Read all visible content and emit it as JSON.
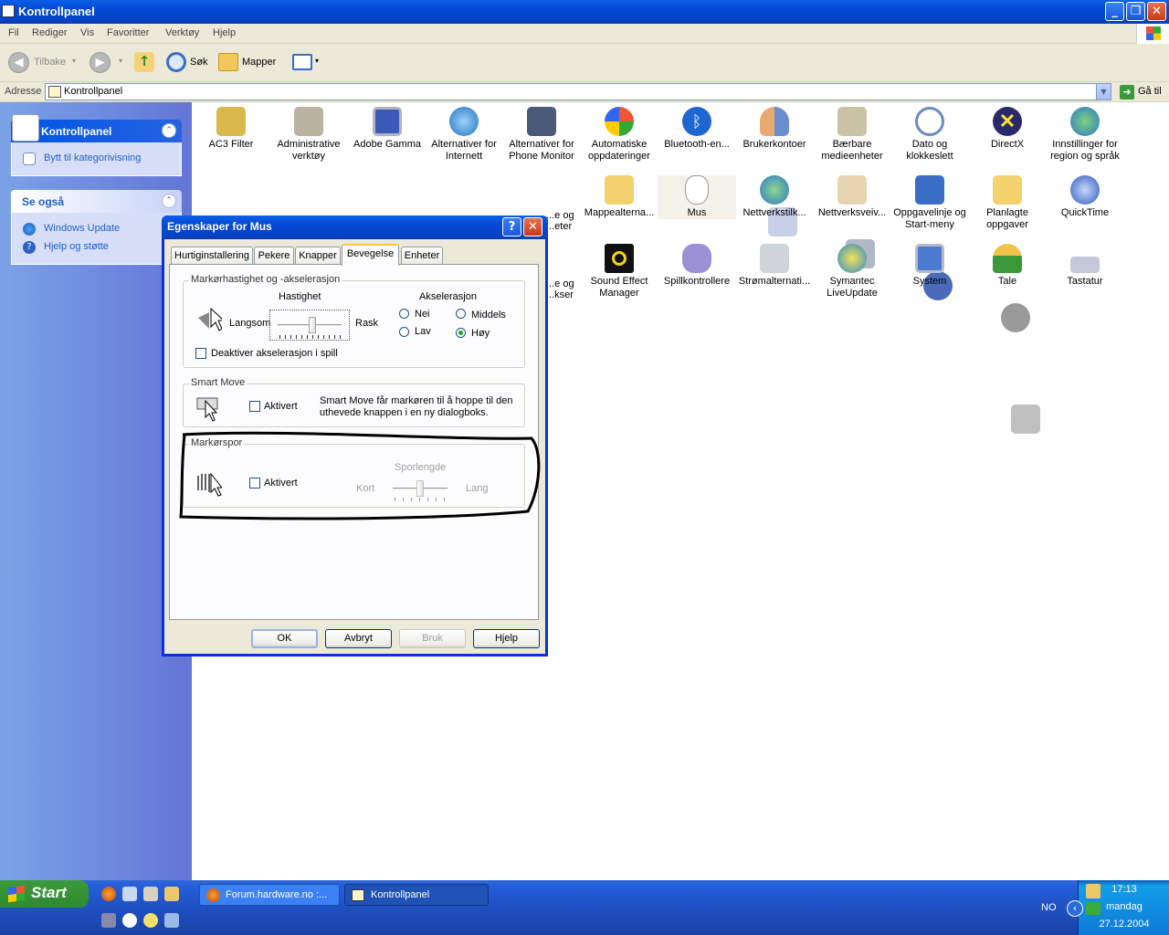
{
  "window": {
    "title": "Kontrollpanel"
  },
  "menu": [
    "Fil",
    "Rediger",
    "Vis",
    "Favoritter",
    "Verktøy",
    "Hjelp"
  ],
  "toolbar": {
    "back": "Tilbake",
    "search": "Søk",
    "folders": "Mapper"
  },
  "address": {
    "label": "Adresse",
    "value": "Kontrollpanel",
    "go": "Gå til"
  },
  "sidebar": {
    "panel1": {
      "title": "Kontrollpanel",
      "link": "Bytt til kategorivisning"
    },
    "panel2": {
      "title": "Se også",
      "links": [
        "Windows Update",
        "Hjelp og støtte"
      ]
    }
  },
  "items": [
    {
      "l1": "AC3 Filter",
      "l2": ""
    },
    {
      "l1": "Administrative",
      "l2": "verktøy"
    },
    {
      "l1": "Adobe Gamma",
      "l2": ""
    },
    {
      "l1": "Alternativer for",
      "l2": "Internett"
    },
    {
      "l1": "Alternativer for",
      "l2": "Phone Monitor"
    },
    {
      "l1": "Automatiske",
      "l2": "oppdateringer"
    },
    {
      "l1": "Bluetooth-en...",
      "l2": ""
    },
    {
      "l1": "Brukerkontoer",
      "l2": ""
    },
    {
      "l1": "Bærbare",
      "l2": "medieenheter"
    },
    {
      "l1": "Dato og",
      "l2": "klokkeslett"
    },
    {
      "l1": "DirectX",
      "l2": ""
    },
    {
      "l1": "Innstillinger for",
      "l2": "region og språk"
    }
  ],
  "items_row2": [
    {
      "l1": "Mappealterna...",
      "l2": ""
    },
    {
      "l1": "Mus",
      "l2": ""
    },
    {
      "l1": "Nettverkstilk...",
      "l2": ""
    },
    {
      "l1": "Nettverksveiv...",
      "l2": ""
    },
    {
      "l1": "Oppgavelinje og",
      "l2": "Start-meny"
    },
    {
      "l1": "Planlagte",
      "l2": "oppgaver"
    },
    {
      "l1": "QuickTime",
      "l2": ""
    }
  ],
  "items_row2_partial": {
    "l1": "...e og",
    "l2": "...eter"
  },
  "items_row3": [
    {
      "l1": "Sound Effect",
      "l2": "Manager"
    },
    {
      "l1": "Spillkontrollere",
      "l2": ""
    },
    {
      "l1": "Strømalternati...",
      "l2": ""
    },
    {
      "l1": "Symantec",
      "l2": "LiveUpdate"
    },
    {
      "l1": "System",
      "l2": ""
    },
    {
      "l1": "Tale",
      "l2": ""
    },
    {
      "l1": "Tastatur",
      "l2": ""
    }
  ],
  "items_row3_partial": {
    "l1": "...e og",
    "l2": "...kser"
  },
  "dialog": {
    "title": "Egenskaper for Mus",
    "tabs": [
      "Hurtiginstallering",
      "Pekere",
      "Knapper",
      "Bevegelse",
      "Enheter"
    ],
    "active_tab": "Bevegelse",
    "speed_group": {
      "label": "Markørhastighet og -akselerasjon",
      "speed_label": "Hastighet",
      "slow": "Langsom",
      "fast": "Rask",
      "accel_label": "Akselerasjon",
      "options": [
        "Nei",
        "Middels",
        "Lav",
        "Høy"
      ],
      "selected": "Høy",
      "disable_game": "Deaktiver akselerasjon i spill"
    },
    "smart_move": {
      "label": "Smart Move",
      "checkbox": "Aktivert",
      "description1": "Smart Move får markøren til å hoppe til den",
      "description2": "uthevede knappen i en ny dialogboks."
    },
    "trail": {
      "label": "Markørspor",
      "checkbox": "Aktivert",
      "length_label": "Sporlengde",
      "short": "Kort",
      "long": "Lang"
    },
    "buttons": {
      "ok": "OK",
      "cancel": "Avbryt",
      "apply": "Bruk",
      "help": "Hjelp"
    }
  },
  "taskbar": {
    "start": "Start",
    "tasks": [
      "Forum.hardware.no :...",
      "Kontrollpanel"
    ],
    "lang": "NO",
    "time": "17:13",
    "day": "mandag",
    "date": "27.12.2004"
  }
}
